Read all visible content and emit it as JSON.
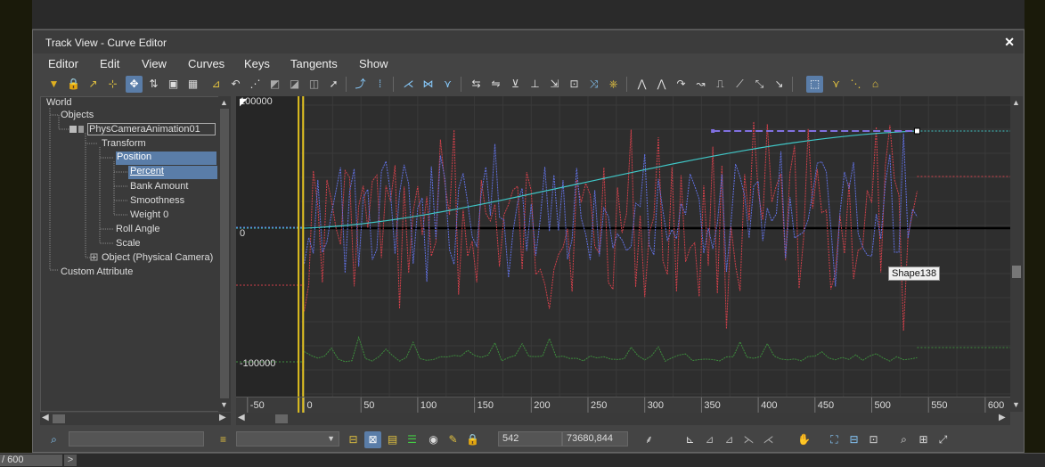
{
  "window": {
    "title": "Track View - Curve Editor",
    "close_label": "✕"
  },
  "menu": [
    "Editor",
    "Edit",
    "View",
    "Curves",
    "Keys",
    "Tangents",
    "Show"
  ],
  "tree": {
    "world": "World",
    "objects": "Objects",
    "camera": "PhysCameraAnimation01",
    "transform": "Transform",
    "position": "Position",
    "percent": "Percent",
    "bank": "Bank Amount",
    "smooth": "Smoothness",
    "weight": "Weight 0",
    "roll": "Roll Angle",
    "scale": "Scale",
    "object": "Object (Physical Camera)",
    "custom": "Custom Attribute"
  },
  "curve_editor": {
    "y_labels": {
      "top": "100000",
      "zero": "0",
      "bottom": "-100000"
    },
    "x_ticks": [
      "-50",
      "0",
      "50",
      "100",
      "150",
      "200",
      "250",
      "300",
      "350",
      "400",
      "450",
      "500",
      "550",
      "600"
    ],
    "tooltip": "Shape138",
    "colors": {
      "x": "#d0404a",
      "y": "#6070e0",
      "z": "#3d8c3d",
      "percent": "#40c8c8",
      "playhead": "#e0c020"
    }
  },
  "status": {
    "frame": "542",
    "value": "73680,844"
  },
  "timeline": {
    "counter": "/ 600",
    "next": ">"
  }
}
